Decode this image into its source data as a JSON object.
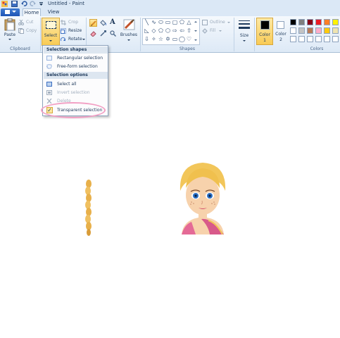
{
  "window": {
    "title": "Untitled - Paint"
  },
  "quick_access": {
    "icons": [
      "paint-app-icon",
      "save-icon",
      "undo-icon",
      "redo-icon",
      "customize-icon"
    ]
  },
  "tabs": {
    "home": "Home",
    "view": "View"
  },
  "clipboard": {
    "paste": "Paste",
    "cut": "Cut",
    "copy": "Copy",
    "group_label": "Clipboard"
  },
  "image": {
    "select": "Select",
    "crop": "Crop",
    "resize": "Resize",
    "rotate": "Rotate"
  },
  "tools": {
    "brushes": "Brushes"
  },
  "shapes": {
    "outline": "Outline",
    "fill": "Fill",
    "group_label": "Shapes"
  },
  "size": {
    "label": "Size"
  },
  "colors": {
    "color1_label": "Color",
    "color1_num": "1",
    "color2_label": "Color",
    "color2_num": "2",
    "group_label": "Colors",
    "color1": "#000000",
    "color2": "#ffffff",
    "palette_row1": [
      "#000000",
      "#7f7f7f",
      "#880015",
      "#ed1c24",
      "#ff7f27",
      "#fff200"
    ],
    "palette_row2": [
      "#ffffff",
      "#c3c3c3",
      "#b97a57",
      "#ffaec9",
      "#ffc90e",
      "#efe4b0"
    ],
    "palette_row3": [
      "#ffffff",
      "#ffffff",
      "#ffffff",
      "#ffffff",
      "#ffffff",
      "#ffffff"
    ]
  },
  "select_menu": {
    "shapes_header": "Selection shapes",
    "rectangular": "Rectangular selection",
    "freeform": "Free-form selection",
    "options_header": "Selection options",
    "select_all": "Select all",
    "invert": "Invert selection",
    "delete": "Delete",
    "transparent": "Transparent selection",
    "transparent_checked": true
  }
}
